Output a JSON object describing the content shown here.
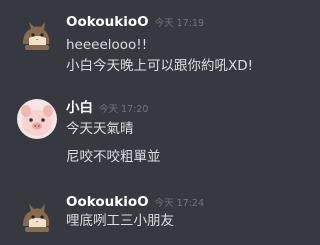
{
  "messages": [
    {
      "author": "OokoukioO",
      "timestamp": "今天 17:19",
      "avatar": "furret-avatar",
      "lines": [
        "heeeelooo!!",
        "小白今天晚上可以跟你約吼XD!"
      ]
    },
    {
      "author": "小白",
      "timestamp": "今天 17:20",
      "avatar": "pig-avatar",
      "lines": [
        "今天天氣晴",
        "尼咬不咬粗單並"
      ]
    },
    {
      "author": "OokoukioO",
      "timestamp": "今天 17:24",
      "avatar": "furret-avatar",
      "lines": [
        "哩底咧工三小朋友"
      ]
    }
  ],
  "colors": {
    "background": "#36393f",
    "username": "#ffffff",
    "text": "#dcddde",
    "timestamp": "#72767d"
  }
}
